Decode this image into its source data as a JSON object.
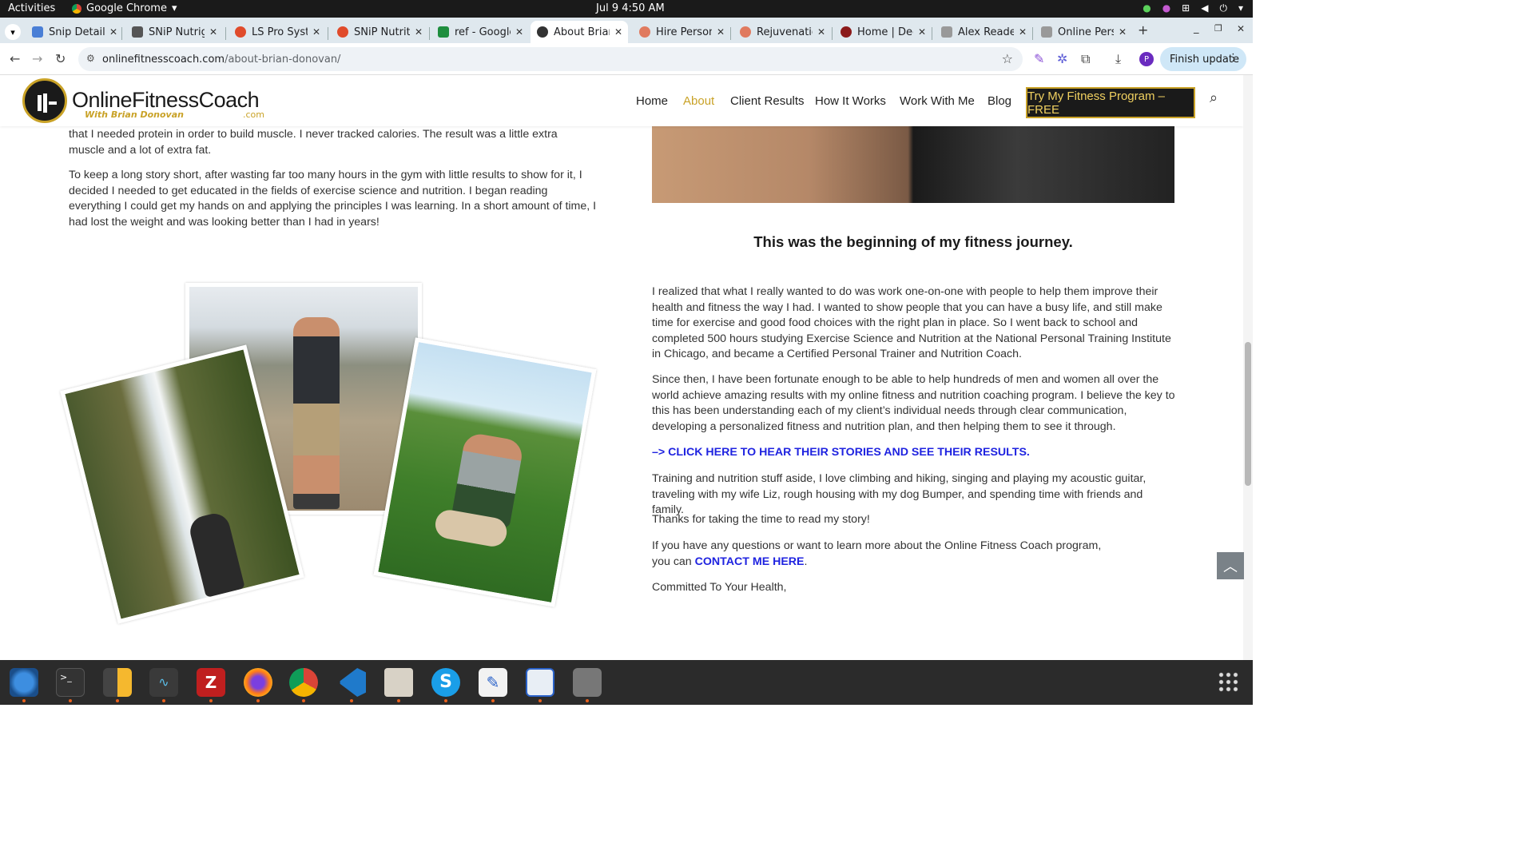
{
  "system": {
    "activities": "Activities",
    "app_name": "Google Chrome",
    "clock": "Jul 9  4:50 AM"
  },
  "tabs": [
    {
      "label": "Snip Details",
      "color": "#4a7fd6"
    },
    {
      "label": "SNiP Nutrig",
      "color": "#333333"
    },
    {
      "label": "LS Pro Syste",
      "color": "#e04b2b"
    },
    {
      "label": "SNiP Nutriti",
      "color": "#e04b2b"
    },
    {
      "label": "ref - Google",
      "color": "#1e8e3e"
    },
    {
      "label": "About Brian",
      "color": "#333333"
    },
    {
      "label": "Hire Person",
      "color": "#e07a5f"
    },
    {
      "label": "Rejuvenatio",
      "color": "#e07a5f"
    },
    {
      "label": "Home | Decl",
      "color": "#8b1a1a"
    },
    {
      "label": "Alex Reader",
      "color": "#888888"
    },
    {
      "label": "Online Pers",
      "color": "#888888"
    }
  ],
  "browser": {
    "url_host": "onlinefitnesscoach.com",
    "url_path": "/about-brian-donovan/",
    "finish_update": "Finish update",
    "profile_initial": "P"
  },
  "site": {
    "logo_name": "OnlineFitnessCoach",
    "logo_sub": "With Brian Donovan",
    "logo_com": ".com",
    "nav": [
      "Home",
      "About",
      "Client Results",
      "How It Works",
      "Work With Me",
      "Blog"
    ],
    "cta": "Try My Fitness Program – FREE",
    "left_p1": "that I needed protein in order to build muscle. I never tracked calories. The result was a little extra muscle and a lot of extra fat.",
    "left_p2": "To keep a long story short, after wasting far too many hours in the gym with little results to show for it, I decided I needed to get educated in the fields of exercise science and nutrition. I began reading everything I could get my hands on and applying the principles I was learning. In a short amount of time, I had lost the weight and was looking better than I had in years!",
    "heading": "This was the beginning of my fitness journey.",
    "right_p1": "I realized that what I really wanted to do was work one-on-one with people to help them improve their health and fitness the way I had. I wanted to show people that you can have a busy life, and still make time for exercise and good food choices with the right plan in place. So I went back to school and completed 500 hours studying Exercise Science and Nutrition at the National Personal Training Institute in Chicago, and became a Certified Personal Trainer and Nutrition Coach.",
    "right_p2": "Since then, I have been fortunate enough to be able to help hundreds of men and women all over the world achieve amazing results with my online fitness and nutrition coaching program. I believe the key to this has been understanding each of my client’s individual needs through clear communication, developing a personalized fitness and nutrition plan, and then helping them to see it through.",
    "results_link": "–> CLICK HERE TO HEAR THEIR STORIES AND SEE THEIR RESULTS.",
    "right_p3": "Training and nutrition stuff aside, I love climbing and hiking, singing and playing my acoustic guitar, traveling with my wife Liz, rough housing with my dog Bumper, and spending time with friends and family.",
    "right_p4": "Thanks for taking the time to read my story!",
    "right_p5_pre": "If you have any questions or want to learn more about the Online Fitness Coach program, you can ",
    "contact_link": "CONTACT ME HERE",
    "right_p5_post": ".",
    "signoff": "Committed To Your Health,"
  },
  "colors": {
    "accent_gold": "#c9a227",
    "link_blue": "#1f23e0",
    "nav_active": "#c9a227"
  },
  "dock": [
    "thunderbird-icon",
    "terminal-icon",
    "calculator-icon",
    "system-monitor-icon",
    "filezilla-icon",
    "firefox-icon",
    "chrome-icon",
    "vscode-icon",
    "files-icon",
    "skype-icon",
    "text-editor-icon",
    "document-viewer-icon",
    "disk-icon"
  ]
}
